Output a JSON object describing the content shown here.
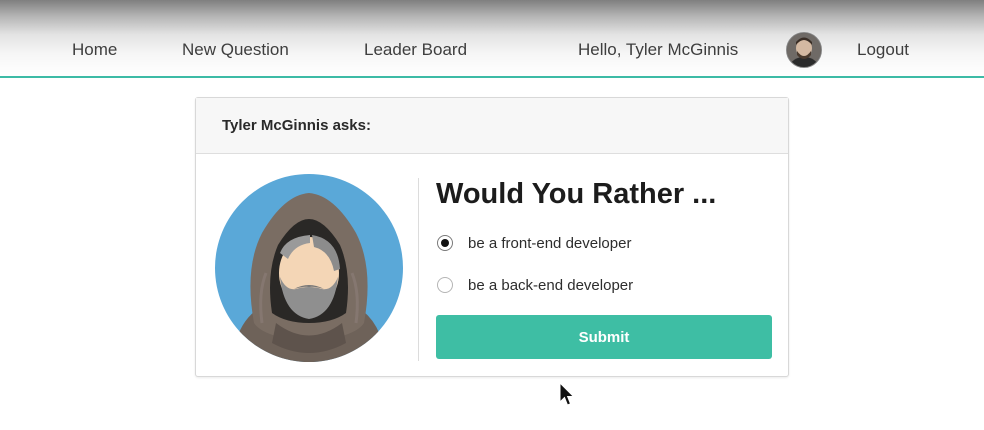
{
  "nav": {
    "home": "Home",
    "new_question": "New Question",
    "leader_board": "Leader Board",
    "greeting": "Hello, Tyler McGinnis",
    "logout": "Logout",
    "avatar_icon": "user-avatar-icon"
  },
  "poll": {
    "header": "Tyler McGinnis asks:",
    "title": "Would You Rather ...",
    "options": [
      {
        "label": "be a front-end developer",
        "selected": true
      },
      {
        "label": "be a back-end developer",
        "selected": false
      }
    ],
    "submit_label": "Submit",
    "author_avatar_icon": "hooded-man-avatar-icon"
  },
  "colors": {
    "accent": "#3ebea4",
    "nav_border": "#3dbba6",
    "avatar_bg": "#5aa8d8"
  }
}
